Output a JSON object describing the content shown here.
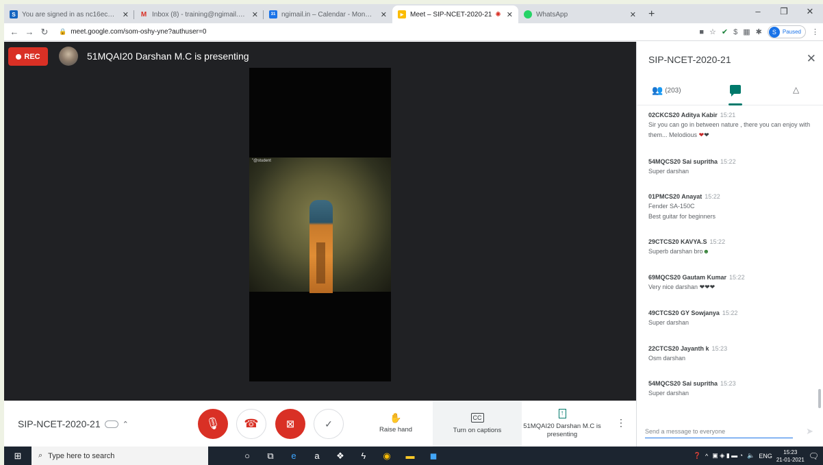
{
  "browser": {
    "tabs": [
      {
        "title": "You are signed in as nc16ec001",
        "icon": "s-icon",
        "color": "#1565c0",
        "letter": "S"
      },
      {
        "title": "Inbox (8) - training@ngimail.in -",
        "icon": "gmail-icon",
        "color": "#ffffff",
        "letter": "M"
      },
      {
        "title": "ngimail.in – Calendar - Monday,",
        "icon": "calendar-icon",
        "color": "#1a73e8",
        "letter": "31"
      },
      {
        "title": "Meet – SIP-NCET-2020-21",
        "icon": "meet-icon",
        "color": "#fbbc04",
        "letter": "▶",
        "active": true
      },
      {
        "title": "WhatsApp",
        "icon": "whatsapp-icon",
        "color": "#25d366",
        "letter": "●"
      }
    ],
    "new_tab": "+",
    "url": "meet.google.com/som-oshy-yne?authuser=0",
    "profile_initial": "S",
    "profile_status": "Paused"
  },
  "meet": {
    "rec_label": "REC",
    "presenting": "51MQAI20 Darshan M.C is presenting",
    "video_caption": "\"@student",
    "meeting_name": "SIP-NCET-2020-21",
    "raise_hand": "Raise hand",
    "captions": "Turn on captions",
    "presenter_box": "51MQAI20 Darshan M.C is presenting"
  },
  "panel": {
    "title": "SIP-NCET-2020-21",
    "participants": "(203)",
    "compose_placeholder": "Send a message to everyone",
    "messages": [
      {
        "sender": "02CKCS20 Aditya Kabir",
        "time": "15:21",
        "text": "Sir you can go in between nature , there you can enjoy with them... Melodious",
        "hearts": "red"
      },
      {
        "sender": "54MQCS20 Sai supritha",
        "time": "15:22",
        "text": "Super darshan"
      },
      {
        "sender": "01PMCS20 Anayat",
        "time": "15:22",
        "text": "Fender SA-150C\nBest guitar for beginners"
      },
      {
        "sender": "29CTCS20 KAVYA.S",
        "time": "15:22",
        "text": "Superb darshan bro"
      },
      {
        "sender": "69MQCS20 Gautam Kumar",
        "time": "15:22",
        "text": "Very nice darshan"
      },
      {
        "sender": "49CTCS20 GY Sowjanya",
        "time": "15:22",
        "text": "Super darshan"
      },
      {
        "sender": "22CTCS20 Jayanth k",
        "time": "15:23",
        "text": "Osm darshan"
      },
      {
        "sender": "54MQCS20 Sai supritha",
        "time": "15:23",
        "text": "Super darshan"
      }
    ]
  },
  "taskbar": {
    "search_placeholder": "Type here to search",
    "lang": "ENG",
    "time": "15:23",
    "date": "21-01-2021"
  }
}
